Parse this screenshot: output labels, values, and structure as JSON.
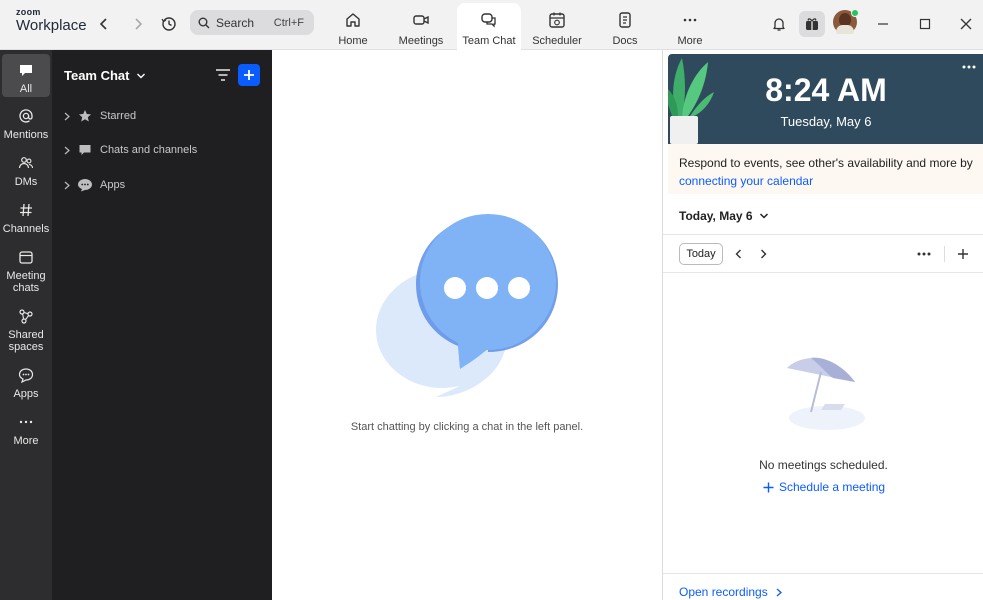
{
  "app": {
    "brand_top": "zoom",
    "brand_bottom": "Workplace"
  },
  "search": {
    "placeholder": "Search",
    "shortcut": "Ctrl+F"
  },
  "tabs": [
    {
      "label": "Home",
      "icon": "home-icon"
    },
    {
      "label": "Meetings",
      "icon": "video-icon"
    },
    {
      "label": "Team Chat",
      "icon": "chat-icon",
      "active": true
    },
    {
      "label": "Scheduler",
      "icon": "scheduler-icon"
    },
    {
      "label": "Docs",
      "icon": "doc-icon"
    },
    {
      "label": "More",
      "icon": "more-icon"
    }
  ],
  "rail": [
    {
      "label": "All",
      "icon": "chat-bubble-icon",
      "active": true
    },
    {
      "label": "Mentions",
      "icon": "at-icon"
    },
    {
      "label": "DMs",
      "icon": "people-icon"
    },
    {
      "label": "Channels",
      "icon": "hash-icon"
    },
    {
      "label_l1": "Meeting",
      "label_l2": "chats",
      "icon": "calendar-icon"
    },
    {
      "label_l1": "Shared",
      "label_l2": "spaces",
      "icon": "share-icon"
    },
    {
      "label": "Apps",
      "icon": "apps-icon"
    },
    {
      "label": "More",
      "icon": "more-icon"
    }
  ],
  "panel": {
    "title": "Team Chat",
    "items": [
      {
        "label": "Starred",
        "icon": "star-icon"
      },
      {
        "label": "Chats and channels",
        "icon": "chat-bubble-icon"
      },
      {
        "label": "Apps",
        "icon": "apps-icon"
      }
    ]
  },
  "center": {
    "hint": "Start chatting by clicking a chat in the left panel."
  },
  "calendar": {
    "time": "8:24 AM",
    "date": "Tuesday, May 6",
    "connect_text": "Respond to events, see other's availability and more by ",
    "connect_link": "connecting your calendar",
    "date_header": "Today, May 6",
    "today_button": "Today",
    "empty_text": "No meetings scheduled.",
    "schedule_link": "Schedule a meeting",
    "recordings_link": "Open recordings"
  },
  "colors": {
    "accent": "#0b5cff",
    "rail_bg": "#2d2d2f",
    "panel_bg": "#1f1f21",
    "clock_bg": "#2e4a5c",
    "presence": "#22c55e"
  }
}
